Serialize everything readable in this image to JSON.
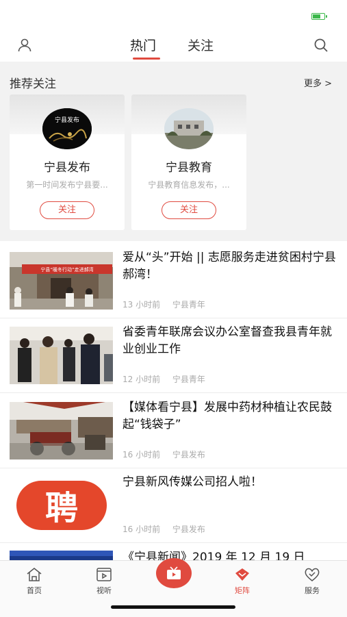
{
  "header": {
    "tabs": [
      {
        "label": "热门",
        "active": true
      },
      {
        "label": "关注",
        "active": false
      }
    ],
    "accent_color": "#e04a3f"
  },
  "recommend": {
    "title": "推荐关注",
    "more": "更多 >",
    "cards": [
      {
        "name": "宁县发布",
        "desc": "第一时间发布宁县要...",
        "follow": "关注"
      },
      {
        "name": "宁县教育",
        "desc": "宁县教育信息发布，...",
        "follow": "关注"
      }
    ]
  },
  "news": [
    {
      "title": "爱从“头”开始 || 志愿服务走进贫困村宁县郝湾！",
      "time": "13 小时前",
      "source": "宁县青年"
    },
    {
      "title": "省委青年联席会议办公室督查我县青年就业创业工作",
      "time": "12 小时前",
      "source": "宁县青年"
    },
    {
      "title": "【媒体看宁县】发展中药材种植让农民鼓起“钱袋子”",
      "time": "16 小时前",
      "source": "宁县发布"
    },
    {
      "title": "宁县新风传媒公司招人啦！",
      "time": "16 小时前",
      "source": "宁县发布"
    },
    {
      "title": "《宁县新闻》2019 年 12 月 19 日"
    }
  ],
  "thumb_text": {
    "banner": "宁县“暖冬行动”走进郝湾",
    "recruit": "聘"
  },
  "bottom_nav": [
    {
      "label": "首页",
      "icon": "home-icon"
    },
    {
      "label": "视听",
      "icon": "play-icon"
    },
    {
      "label": "",
      "icon": "tv-icon"
    },
    {
      "label": "矩阵",
      "icon": "matrix-icon",
      "active": true
    },
    {
      "label": "服务",
      "icon": "heart-icon"
    }
  ]
}
